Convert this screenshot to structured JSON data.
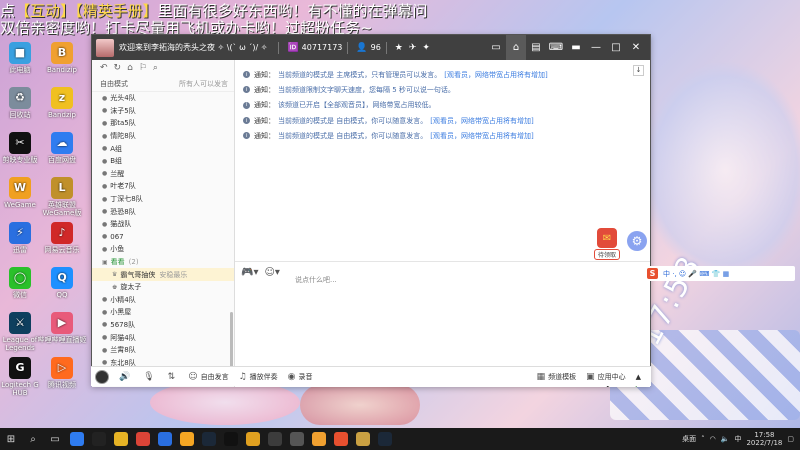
{
  "danmaku": {
    "line1_parts": [
      "点",
      "【互动】",
      "【精英手册】",
      "里面有很多好东西哟！有不懂的在弹幕问"
    ],
    "line2": "双倍亲密度哟！打卡尽量用飞机或办卡哟！过超粉任务~"
  },
  "desktop_icons": [
    {
      "label": "此电脑",
      "color": "#3aa0e0",
      "glyph": "■"
    },
    {
      "label": "Bandizip",
      "color": "#f0a030",
      "glyph": "B"
    },
    {
      "label": "回收站",
      "color": "#7c8c9c",
      "glyph": "♻"
    },
    {
      "label": "Bandzip",
      "color": "#f0c020",
      "glyph": "z"
    },
    {
      "label": "剪映专业版",
      "color": "#111111",
      "glyph": "✂"
    },
    {
      "label": "百度网盘",
      "color": "#2f7cf0",
      "glyph": "☁"
    },
    {
      "label": "WeGame",
      "color": "#f0a020",
      "glyph": "W"
    },
    {
      "label": "英雄联盟WeGame版",
      "color": "#c0902a",
      "glyph": "L"
    },
    {
      "label": "迅雷",
      "color": "#2a6fe0",
      "glyph": "⚡"
    },
    {
      "label": "网易云音乐",
      "color": "#d02828",
      "glyph": "♪"
    },
    {
      "label": "微信",
      "color": "#2ac02a",
      "glyph": "◯"
    },
    {
      "label": "QQ",
      "color": "#1e90ff",
      "glyph": "Q"
    },
    {
      "label": "League of Legends",
      "color": "#0e3f5e",
      "glyph": "⚔"
    },
    {
      "label": "哔哩哔哩直播姬",
      "color": "#e85a7a",
      "glyph": "▶"
    },
    {
      "label": "Logitech G HUB",
      "color": "#111111",
      "glyph": "G"
    },
    {
      "label": "腾讯视频",
      "color": "#ff6a1e",
      "glyph": "▷"
    }
  ],
  "window": {
    "title": "欢迎来到李拓海的秃头之夜 ✧ \\(ˋ ω ˊ)/ ✧",
    "room_id": "40717173",
    "viewers": "96",
    "buttons": {
      "min": "—",
      "max": "□",
      "close": "✕"
    }
  },
  "sidebar": {
    "filter_label": "自由模式",
    "filter_hint": "所有人可以发言",
    "items": [
      {
        "label": "光头4队",
        "type": "channel"
      },
      {
        "label": "沫子5队",
        "type": "channel"
      },
      {
        "label": "那ta5队",
        "type": "channel"
      },
      {
        "label": "情陀8队",
        "type": "channel"
      },
      {
        "label": "A组",
        "type": "channel"
      },
      {
        "label": "B组",
        "type": "channel"
      },
      {
        "label": "兰醒",
        "type": "channel"
      },
      {
        "label": "叶老7队",
        "type": "channel"
      },
      {
        "label": "丁深七8队",
        "type": "channel"
      },
      {
        "label": "恐恐8队",
        "type": "channel"
      },
      {
        "label": "猫战队",
        "type": "channel"
      },
      {
        "label": "067",
        "type": "channel"
      },
      {
        "label": "小鱼",
        "type": "channel"
      },
      {
        "label": "看看",
        "type": "group",
        "count": "(2)"
      },
      {
        "label": "霸气哥抽侠",
        "type": "selected",
        "extra": "安稳最乐"
      },
      {
        "label": "旋太子",
        "type": "member"
      },
      {
        "label": "小精4队",
        "type": "channel"
      },
      {
        "label": "小黑屋",
        "type": "channel"
      },
      {
        "label": "5678队",
        "type": "channel"
      },
      {
        "label": "阿猫4队",
        "type": "channel"
      },
      {
        "label": "兰霄8队",
        "type": "channel"
      },
      {
        "label": "东北8队",
        "type": "channel"
      },
      {
        "label": "辅导办公室",
        "type": "channel"
      }
    ]
  },
  "messages": [
    {
      "label": "通知：",
      "text": "当前频道的模式是 主席模式，只有管理员可以发言。",
      "link": "[观看员，网络带宽占用将有增加]"
    },
    {
      "label": "通知：",
      "text": "当前频道限制文字聊天速度，您每隔 5 秒可以说一句话。",
      "link": ""
    },
    {
      "label": "通知：",
      "text": "该频道已开启【全部观音员】，网络带宽占用较低。",
      "link": ""
    },
    {
      "label": "通知：",
      "text": "当前频道的模式是 自由模式，你可以随意发言。",
      "link": "[观看员，网络带宽占用将有增加]"
    },
    {
      "label": "通知：",
      "text": "当前频道的模式是 自由模式，你可以随意发言。",
      "link": "[观看员，网络带宽占用将有增加]"
    }
  ],
  "gift_label": "待领取",
  "input_placeholder": "说点什么吧...",
  "footer": {
    "items": [
      "自由发言",
      "播放伴奏",
      "录音"
    ],
    "right": [
      "频道模板",
      "应用中心"
    ]
  },
  "ime": {
    "text": "中 ·, ☺ 🎤 ⌨ 👕 ▦"
  },
  "big_clock": "17:58",
  "tray": {
    "time": "17:58",
    "date": "2022/7/18",
    "lang": "中"
  }
}
